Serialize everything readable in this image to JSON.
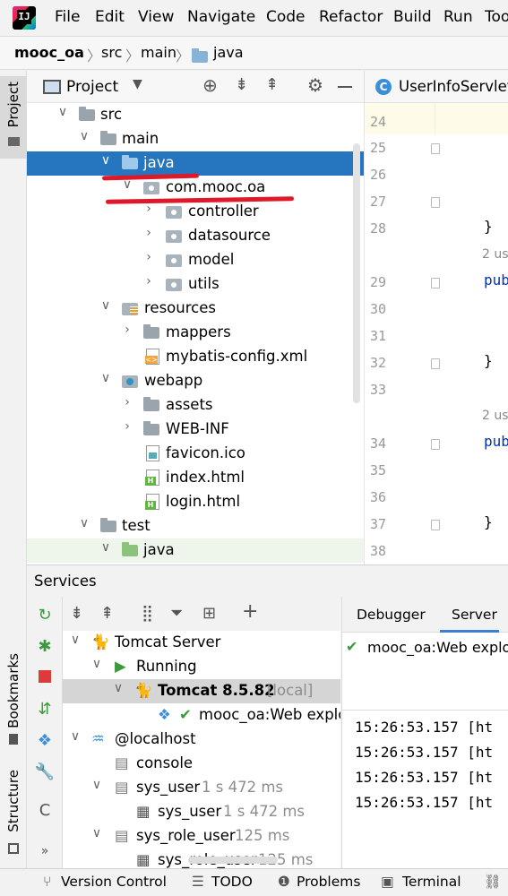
{
  "menu": {
    "items": [
      {
        "label": "File"
      },
      {
        "label": "Edit"
      },
      {
        "label": "View"
      },
      {
        "label": "Navigate"
      },
      {
        "label": "Code"
      },
      {
        "label": "Refactor"
      },
      {
        "label": "Build"
      },
      {
        "label": "Run"
      },
      {
        "label": "Too"
      }
    ]
  },
  "breadcrumb": [
    "mooc_oa",
    "src",
    "main",
    "java"
  ],
  "stripe": {
    "project": "Project",
    "bookmarks": "Bookmarks",
    "structure": "Structure"
  },
  "project_panel": {
    "title": "Project",
    "tree": [
      {
        "label": "src"
      },
      {
        "label": "main"
      },
      {
        "label": "java"
      },
      {
        "label": "com.mooc.oa"
      },
      {
        "label": "controller"
      },
      {
        "label": "datasource"
      },
      {
        "label": "model"
      },
      {
        "label": "utils"
      },
      {
        "label": "resources"
      },
      {
        "label": "mappers"
      },
      {
        "label": "mybatis-config.xml"
      },
      {
        "label": "webapp"
      },
      {
        "label": "assets"
      },
      {
        "label": "WEB-INF"
      },
      {
        "label": "favicon.ico"
      },
      {
        "label": "index.html"
      },
      {
        "label": "login.html"
      },
      {
        "label": "test"
      },
      {
        "label": "java"
      }
    ]
  },
  "editor": {
    "tab_label": "UserInfoServlet.",
    "lines": [
      "24",
      "25",
      "26",
      "27",
      "28",
      "29",
      "30",
      "31",
      "32",
      "33",
      "34",
      "35",
      "36",
      "37",
      "38"
    ],
    "code": {
      "l28": "}",
      "l29": "pub",
      "l32": "}",
      "l34": "pub",
      "l37": "}"
    },
    "hints": {
      "h1": "2 us",
      "h2": "2 us"
    }
  },
  "services": {
    "title": "Services",
    "tabs": {
      "debugger": "Debugger",
      "server": "Server"
    },
    "deployment": "mooc_oa:Web explo",
    "tree": {
      "tomcat_server": "Tomcat Server",
      "running": "Running",
      "tomcat_version": "Tomcat 8.5.82",
      "tomcat_local": "[local]",
      "artifact": "mooc_oa:Web explo",
      "localhost": "@localhost",
      "console": "console",
      "sys_user": "sys_user",
      "sys_user_time": "1 s 472 ms",
      "sys_user_table": "sys_user",
      "sys_user_table_time": "1 s 472 ms",
      "sys_role_user": "sys_role_user",
      "sys_role_user_time": "125 ms",
      "sys_role_user_table": "sys_role_user",
      "sys_role_user_table_time": "125 ms"
    },
    "log": [
      "15:26:53.157 [ht",
      "15:26:53.157 [ht",
      "15:26:53.157 [ht",
      "15:26:53.157 [ht"
    ]
  },
  "bottom_bar": {
    "version_control": "Version Control",
    "todo": "TODO",
    "problems": "Problems",
    "terminal": "Terminal"
  },
  "colors": {
    "selection": "#2675bf",
    "annotation": "#e0192a"
  }
}
